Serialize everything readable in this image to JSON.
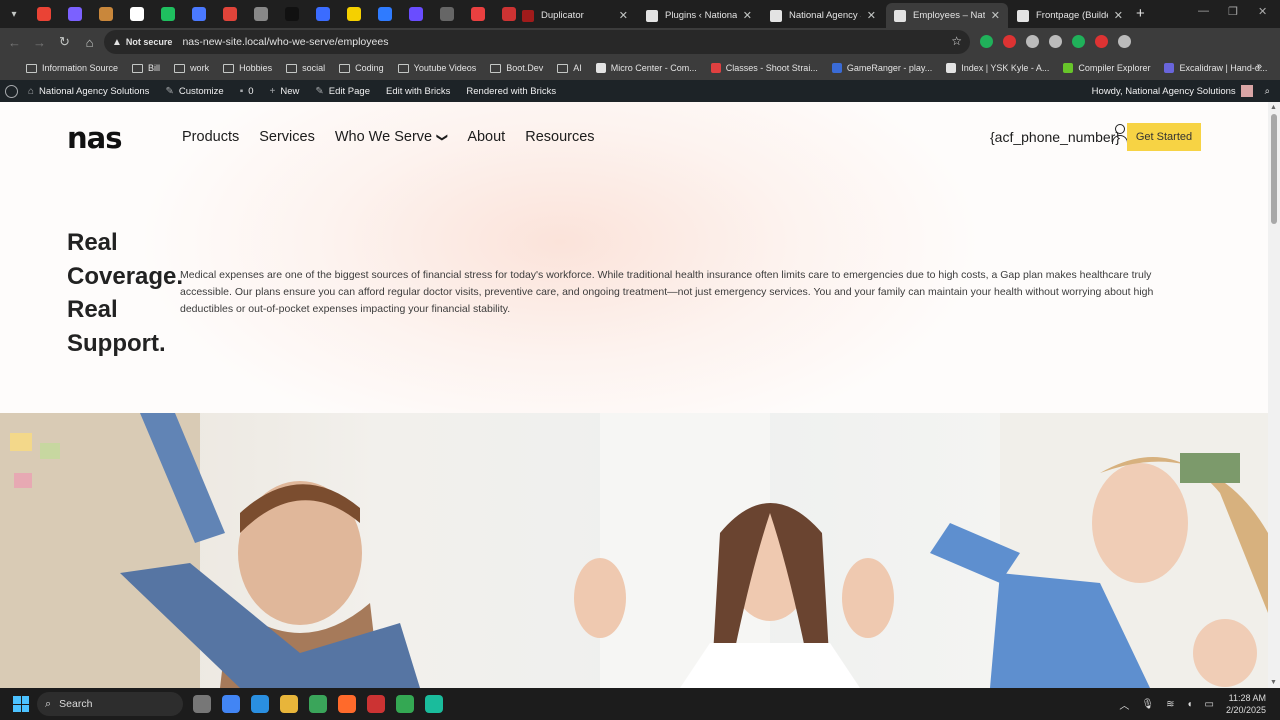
{
  "browser": {
    "tabs": [
      {
        "title": "Duplicator",
        "active": false,
        "fav_color": "#a01b1b"
      },
      {
        "title": "Plugins ‹ National Ag",
        "active": false,
        "fav_color": "#e3e3e3"
      },
      {
        "title": "National Agency Solu",
        "active": false,
        "fav_color": "#e3e3e3"
      },
      {
        "title": "Employees – Nationa",
        "active": true,
        "fav_color": "#e3e3e3"
      },
      {
        "title": "Frontpage (Builder)",
        "active": false,
        "fav_color": "#e3e3e3"
      }
    ],
    "pinned_colors": [
      "#ea4335",
      "#7b61ff",
      "#c9873b",
      "#ffffff",
      "#1fbf5f",
      "#4a79ff",
      "#e0443a",
      "#888888",
      "#111111",
      "#3b6cff",
      "#f5d000",
      "#2f7bff",
      "#6a4dff",
      "#666666",
      "#e94040",
      "#cc3333"
    ],
    "url": "nas-new-site.local/who-we-serve/employees",
    "security_label": "Not secure",
    "extension_colors": [
      "#20b15a",
      "#d33",
      "#bbb",
      "#bbb",
      "#20b15a",
      "#d33",
      "#bbb"
    ]
  },
  "bookmarks": [
    {
      "label": "Information Source",
      "folder": true
    },
    {
      "label": "Bill",
      "folder": true
    },
    {
      "label": "work",
      "folder": true
    },
    {
      "label": "Hobbies",
      "folder": true
    },
    {
      "label": "social",
      "folder": true
    },
    {
      "label": "Coding",
      "folder": true
    },
    {
      "label": "Youtube Videos",
      "folder": true
    },
    {
      "label": "Boot.Dev",
      "folder": true
    },
    {
      "label": "AI",
      "folder": true
    },
    {
      "label": "Micro Center - Com...",
      "folder": false,
      "color": "#e3e3e3"
    },
    {
      "label": "Classes - Shoot Strai...",
      "folder": false,
      "color": "#e04040"
    },
    {
      "label": "GameRanger - play...",
      "folder": false,
      "color": "#3a6bd6"
    },
    {
      "label": "Index | YSK Kyle - A...",
      "folder": false,
      "color": "#e3e3e3"
    },
    {
      "label": "Compiler Explorer",
      "folder": false,
      "color": "#67c52a"
    },
    {
      "label": "Excalidraw | Hand-d...",
      "folder": false,
      "color": "#6965db"
    }
  ],
  "adminbar": {
    "site_name": "National Agency Solutions",
    "customize": "Customize",
    "comments": "0",
    "new": "New",
    "edit_page": "Edit Page",
    "edit_bricks": "Edit with Bricks",
    "rendered": "Rendered with Bricks",
    "howdy": "Howdy, National Agency Solutions"
  },
  "site": {
    "logo": "nas",
    "nav": [
      "Products",
      "Services",
      "Who We Serve",
      "About",
      "Resources"
    ],
    "phone": "{acf_phone_number}",
    "cta": "Get Started",
    "accent": "#f7d344"
  },
  "hero": {
    "title_lines": [
      "Real",
      "Coverage.",
      "Real",
      "Support."
    ],
    "copy": "Medical expenses are one of the biggest sources of financial stress for today's workforce. While traditional health insurance often limits care to emergencies due to high costs, a Gap plan makes healthcare truly accessible. Our plans ensure you can afford regular doctor visits, preventive care, and ongoing treatment—not just emergency services. You and your family can maintain your health without worrying about high deductibles or out-of-pocket expenses impacting your financial stability."
  },
  "taskbar": {
    "search_label": "Search",
    "app_colors": [
      "#777",
      "#4285f4",
      "#2a8fe0",
      "#e8b53a",
      "#3aa55a",
      "#ff6a2b",
      "#c33",
      "#34a853",
      "#1abc9c"
    ],
    "time": "11:28 AM",
    "date": "2/20/2025"
  }
}
